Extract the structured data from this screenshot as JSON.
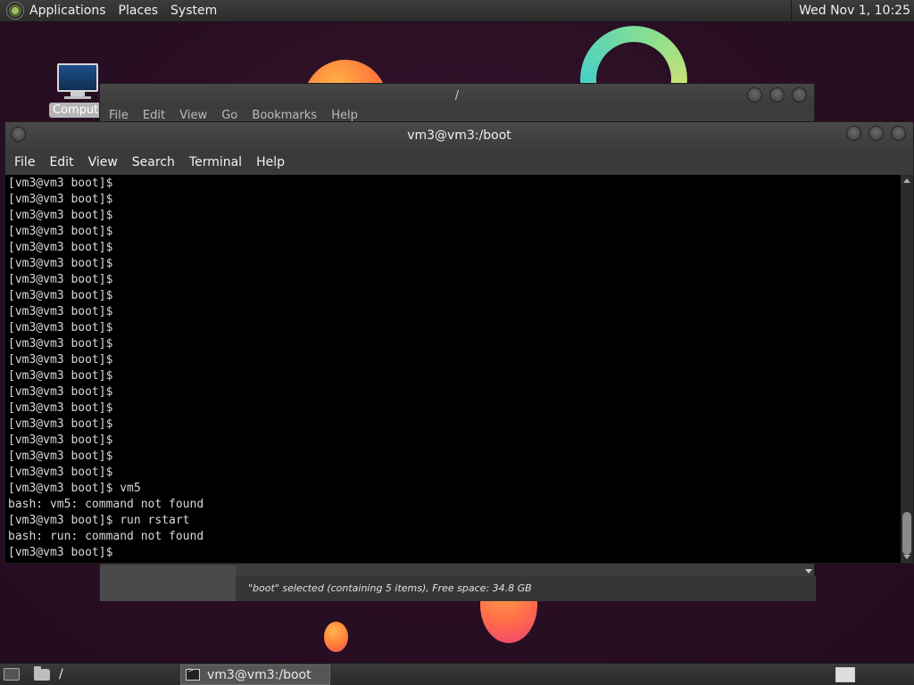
{
  "top_panel": {
    "menus": [
      "Applications",
      "Places",
      "System"
    ],
    "clock": "Wed Nov 1, 10:25"
  },
  "desktop": {
    "icon_label": "Computer"
  },
  "file_manager": {
    "title": "/",
    "menubar": [
      "File",
      "Edit",
      "View",
      "Go",
      "Bookmarks",
      "Help"
    ],
    "status": "\"boot\" selected (containing 5 items), Free space: 34.8 GB"
  },
  "terminal": {
    "title": "vm3@vm3:/boot",
    "menu": [
      "File",
      "Edit",
      "View",
      "Search",
      "Terminal",
      "Help"
    ],
    "lines": [
      "[vm3@vm3 boot]$",
      "[vm3@vm3 boot]$",
      "[vm3@vm3 boot]$",
      "[vm3@vm3 boot]$",
      "[vm3@vm3 boot]$",
      "[vm3@vm3 boot]$",
      "[vm3@vm3 boot]$",
      "[vm3@vm3 boot]$",
      "[vm3@vm3 boot]$",
      "[vm3@vm3 boot]$",
      "[vm3@vm3 boot]$",
      "[vm3@vm3 boot]$",
      "[vm3@vm3 boot]$",
      "[vm3@vm3 boot]$",
      "[vm3@vm3 boot]$",
      "[vm3@vm3 boot]$",
      "[vm3@vm3 boot]$",
      "[vm3@vm3 boot]$",
      "[vm3@vm3 boot]$",
      "[vm3@vm3 boot]$ vm5",
      "bash: vm5: command not found",
      "[vm3@vm3 boot]$ run rstart",
      "bash: run: command not found",
      "[vm3@vm3 boot]$"
    ]
  },
  "taskbar": {
    "tasks": [
      "/",
      "vm3@vm3:/boot"
    ]
  },
  "icons": {
    "menu_logo": "distro-logo-icon",
    "desktop_icon": "computer-icon",
    "show_desktop": "show-desktop-icon",
    "folder": "folder-icon",
    "terminal": "terminal-icon",
    "workspace": "workspace-switcher-icon"
  }
}
